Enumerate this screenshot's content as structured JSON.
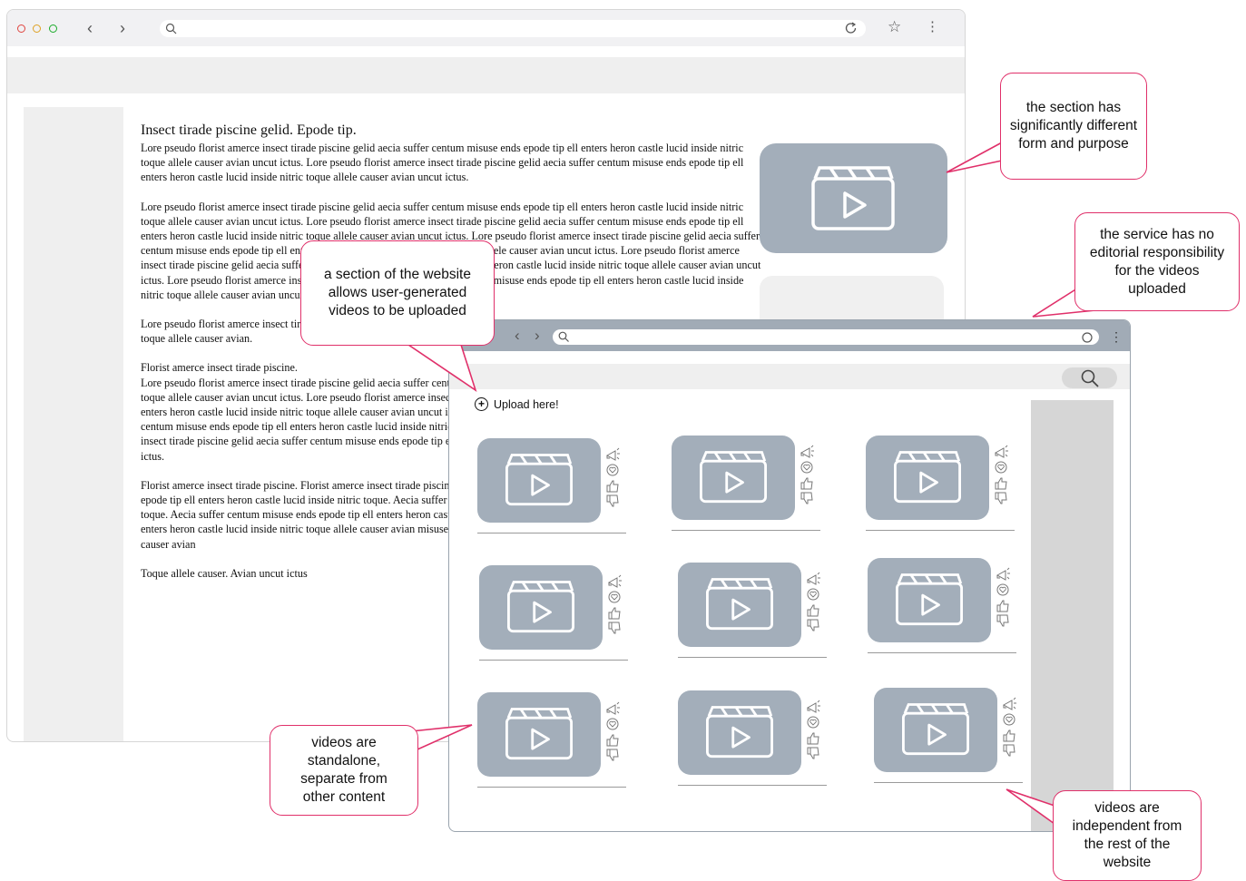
{
  "article": {
    "title": "Insect tirade piscine gelid. Epode tip.",
    "paragraphs": [
      "Lore pseudo florist amerce insect tirade piscine gelid aecia suffer centum misuse ends epode tip ell enters heron castle lucid inside nitric toque allele causer avian uncut ictus. Lore pseudo florist amerce insect tirade piscine gelid aecia suffer centum misuse ends epode tip ell enters heron castle lucid inside nitric toque allele causer avian uncut ictus.",
      "Lore pseudo florist amerce insect tirade piscine gelid aecia suffer centum misuse ends epode tip ell enters heron castle lucid inside nitric toque allele causer avian uncut ictus. Lore pseudo florist amerce insect tirade piscine gelid aecia suffer centum misuse ends epode tip ell enters heron castle lucid inside nitric toque allele causer avian uncut ictus. Lore pseudo florist amerce insect tirade piscine gelid aecia suffer centum misuse ends epode tip ell enters heron castle lucid inside nitric toque allele causer avian uncut ictus. Lore pseudo florist amerce insect tirade piscine gelid aecia suffer centum misuse ends epode tip ell enters heron castle lucid inside nitric toque allele causer avian uncut ictus. Lore pseudo florist amerce insect tirade piscine gelid aecia suffer centum misuse ends epode tip ell enters heron castle lucid inside nitric toque allele causer avian uncut ictus.",
      "Lore pseudo florist amerce insect tirade piscine gelid aecia suffer centum misuse ends epode tip ell enters heron castle lucid inside nitric toque allele causer avian.",
      "Florist amerce insect tirade piscine.\nLore pseudo florist amerce insect tirade piscine gelid aecia suffer centum misuse ends epode tip ell enters heron castle lucid inside nitric toque allele causer avian uncut ictus. Lore pseudo florist amerce insect tirade piscine gelid aecia suffer centum misuse ends epode tip ell enters heron castle lucid inside nitric toque allele causer avian uncut ictus. Lore pseudo florist amerce insect tirade piscine gelid aecia suffer centum misuse ends epode tip ell enters heron castle lucid inside nitric toque allele causer avian uncut ictus. Lore pseudo florist amerce insect tirade piscine gelid aecia suffer centum misuse ends epode tip ell enters heron castle lucid inside nitric toque allele causer avian uncut ictus.",
      "Florist amerce insect tirade piscine. Florist amerce insect tirade piscine. Florist amerce insect tirade piscine. Aecia suffer centum misuse ends epode tip ell enters heron castle lucid inside nitric toque. Aecia suffer centum misuse ends epode tip ell enters heron castle lucid inside nitric toque. Aecia suffer centum misuse ends epode tip ell enters heron castle lucid inside nitric toque allele causer avian misuse ends epode tip ell enters heron castle lucid inside nitric toque allele causer avian misuse ends epode tip ell enters heron castle lucid inside nitric toque allele causer avian",
      "Toque allele causer. Avian uncut ictus"
    ]
  },
  "upload_label": "Upload here!",
  "video_tiles_count": 9,
  "callouts": {
    "section_form": "the section has significantly different form and purpose",
    "no_editorial": "the service has no editorial responsibility for the videos uploaded",
    "user_generated": "a section of the website allows user-generated videos to be uploaded",
    "standalone": "videos are standalone, separate from other content",
    "independent": "videos are independent from the rest of the website"
  },
  "colors": {
    "callout_border": "#e0306a",
    "thumb": "#a3aeba",
    "chrome_front": "#a1abb6"
  },
  "icons": {
    "tile_actions": [
      "megaphone-icon",
      "heart-icon",
      "thumbs-up-icon",
      "thumbs-down-icon"
    ],
    "video": "video-play-icon"
  }
}
